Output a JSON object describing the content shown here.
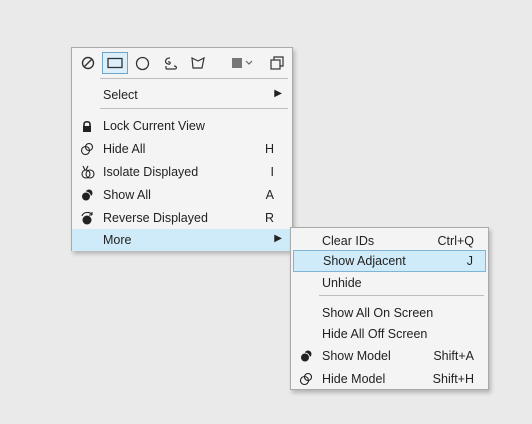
{
  "toolbar": {
    "tools": [
      {
        "icon": "no-selection-icon"
      },
      {
        "icon": "rectangle-select-icon",
        "active": true
      },
      {
        "icon": "circle-select-icon"
      },
      {
        "icon": "freehand-select-icon"
      },
      {
        "icon": "polygon-select-icon"
      },
      {
        "icon": "fill-square-icon"
      },
      {
        "icon": "chevron-down-icon"
      },
      {
        "icon": "copy-windows-icon"
      }
    ]
  },
  "main_menu": {
    "select_label": "Select",
    "items": [
      {
        "label": "Lock Current View",
        "shortcut": "",
        "icon": "lock-icon"
      },
      {
        "label": "Hide All",
        "shortcut": "H",
        "icon": "hide-all-icon"
      },
      {
        "label": "Isolate Displayed",
        "shortcut": "I",
        "icon": "isolate-icon"
      },
      {
        "label": "Show All",
        "shortcut": "A",
        "icon": "show-all-icon"
      },
      {
        "label": "Reverse Displayed",
        "shortcut": "R",
        "icon": "reverse-icon"
      }
    ],
    "more_label": "More"
  },
  "sub_menu": {
    "group1": [
      {
        "label": "Clear IDs",
        "shortcut": "Ctrl+Q"
      },
      {
        "label": "Show Adjacent",
        "shortcut": "J"
      },
      {
        "label": "Unhide",
        "shortcut": ""
      }
    ],
    "group2": [
      {
        "label": "Show All On Screen",
        "shortcut": "",
        "icon": ""
      },
      {
        "label": "Hide All Off Screen",
        "shortcut": "",
        "icon": ""
      },
      {
        "label": "Show Model",
        "shortcut": "Shift+A",
        "icon": "show-model-icon"
      },
      {
        "label": "Hide Model",
        "shortcut": "Shift+H",
        "icon": "hide-model-icon"
      }
    ]
  },
  "colors": {
    "highlight": "#cfeaf8",
    "highlight_border": "#7fb4d4",
    "menu_bg": "#f4f4f4",
    "page_bg": "#eaeaea"
  }
}
